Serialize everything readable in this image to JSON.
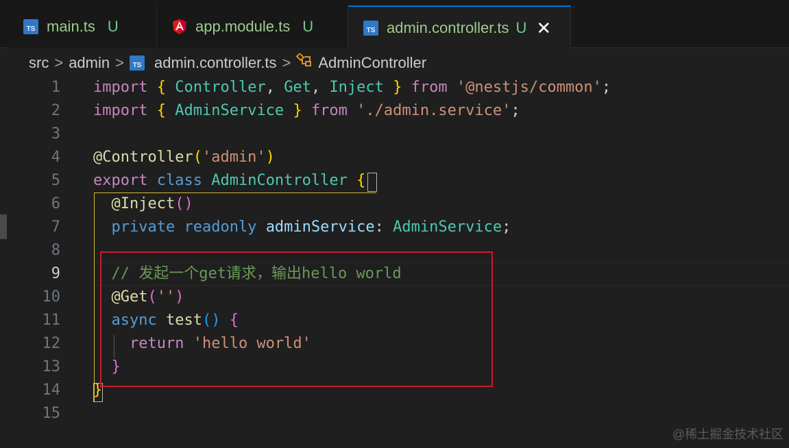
{
  "tabs": [
    {
      "name": "main.ts",
      "status": "U",
      "icon": "typescript-icon",
      "active": false
    },
    {
      "name": "app.module.ts",
      "status": "U",
      "icon": "angular-icon",
      "active": false
    },
    {
      "name": "admin.controller.ts",
      "status": "U",
      "icon": "typescript-icon",
      "active": true,
      "close": "✕"
    }
  ],
  "ts_icon_text": "TS",
  "breadcrumb": {
    "items": [
      "src",
      "admin",
      "admin.controller.ts",
      "AdminController"
    ],
    "separator": ">"
  },
  "code_lines": [
    {
      "num": "1",
      "text": "import { Controller, Get, Inject } from '@nestjs/common';"
    },
    {
      "num": "2",
      "text": "import { AdminService } from './admin.service';"
    },
    {
      "num": "3",
      "text": ""
    },
    {
      "num": "4",
      "text": "@Controller('admin')"
    },
    {
      "num": "5",
      "text": "export class AdminController {"
    },
    {
      "num": "6",
      "text": "  @Inject()"
    },
    {
      "num": "7",
      "text": "  private readonly adminService: AdminService;"
    },
    {
      "num": "8",
      "text": ""
    },
    {
      "num": "9",
      "text": "  // 发起一个get请求，输出hello world"
    },
    {
      "num": "10",
      "text": "  @Get('')"
    },
    {
      "num": "11",
      "text": "  async test() {"
    },
    {
      "num": "12",
      "text": "    return 'hello world'"
    },
    {
      "num": "13",
      "text": "  }"
    },
    {
      "num": "14",
      "text": "}"
    },
    {
      "num": "15",
      "text": ""
    }
  ],
  "current_line": "9",
  "watermark": "@稀土掘金技术社区",
  "colors": {
    "background": "#1f1f1f",
    "keyword": "#569cd6",
    "control": "#c586c0",
    "string": "#ce9178",
    "class": "#4ec9b0",
    "comment": "#6a9955",
    "highlight_box": "#d0192b",
    "active_tab_border": "#0078d4"
  }
}
